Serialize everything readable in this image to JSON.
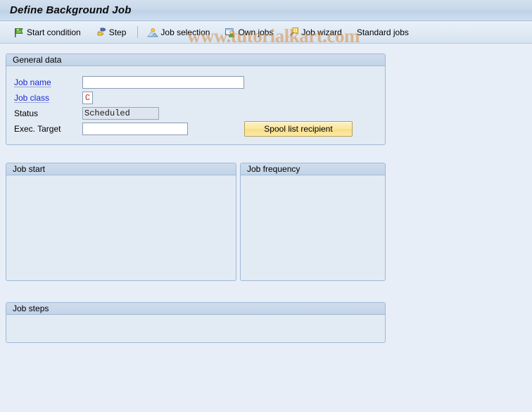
{
  "window": {
    "title": "Define Background Job"
  },
  "watermark": {
    "text": "www.tutorialkart.com"
  },
  "toolbar": {
    "items": [
      {
        "label": "Start condition",
        "icon": "green-flag-icon"
      },
      {
        "label": "Step",
        "icon": "steps-arrow-icon"
      },
      {
        "label": "Job selection",
        "icon": "sunrise-mountain-icon"
      },
      {
        "label": "Own jobs",
        "icon": "person-card-icon"
      },
      {
        "label": "Job wizard",
        "icon": "magic-wand-icon"
      },
      {
        "label": "Standard jobs",
        "icon": "none"
      }
    ]
  },
  "general_data": {
    "title": "General data",
    "fields": {
      "job_name": {
        "label": "Job name",
        "value": "",
        "placeholder": ""
      },
      "job_class": {
        "label": "Job class",
        "value": "C",
        "placeholder": ""
      },
      "status": {
        "label": "Status",
        "value": "Scheduled"
      },
      "exec_target": {
        "label": "Exec. Target",
        "value": "",
        "placeholder": ""
      }
    },
    "spool_button_label": "Spool list recipient"
  },
  "job_start": {
    "title": "Job start"
  },
  "job_frequency": {
    "title": "Job frequency"
  },
  "job_steps": {
    "title": "Job steps"
  },
  "colors": {
    "background": "#e8eef7",
    "panel": "#e2eaf4",
    "panel_border": "#9fb8d4",
    "link_label": "#1a2ad0",
    "job_class_value": "#d02020",
    "button_yellow": "#fbe79e",
    "watermark": "#d68634"
  }
}
